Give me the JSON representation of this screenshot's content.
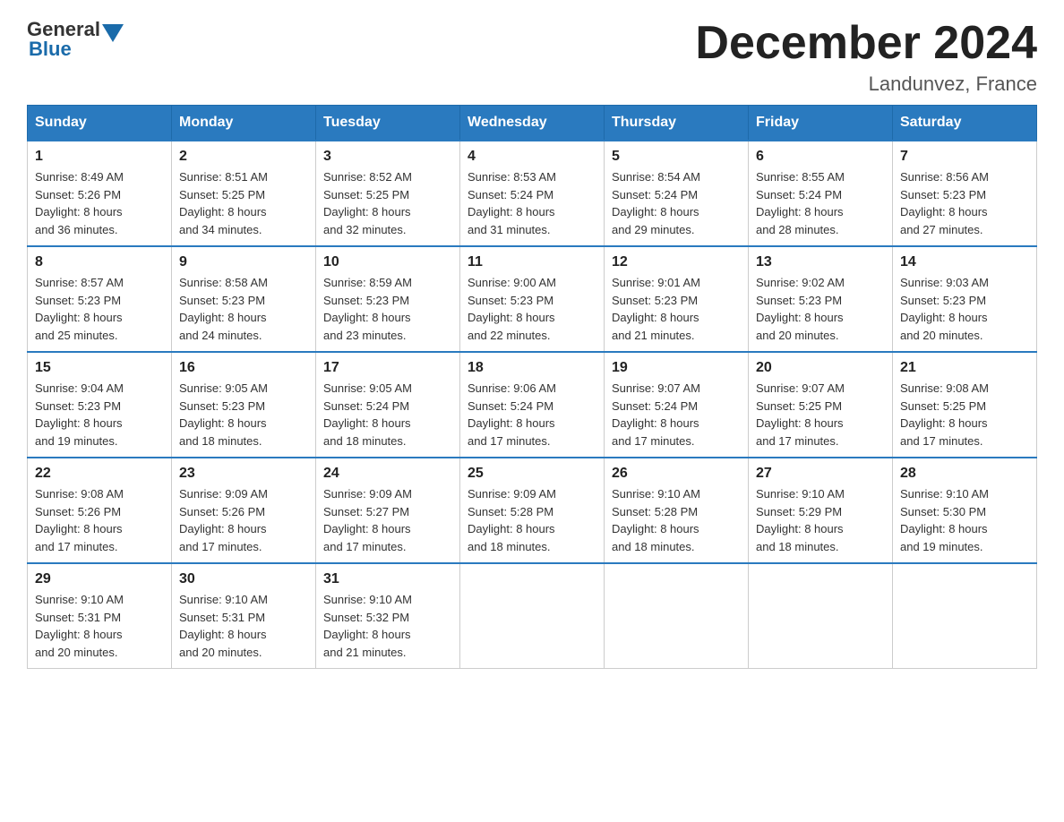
{
  "header": {
    "logo_general": "General",
    "logo_blue": "Blue",
    "month_title": "December 2024",
    "location": "Landunvez, France"
  },
  "days_of_week": [
    "Sunday",
    "Monday",
    "Tuesday",
    "Wednesday",
    "Thursday",
    "Friday",
    "Saturday"
  ],
  "weeks": [
    [
      {
        "day": "1",
        "sunrise": "8:49 AM",
        "sunset": "5:26 PM",
        "daylight": "8 hours and 36 minutes."
      },
      {
        "day": "2",
        "sunrise": "8:51 AM",
        "sunset": "5:25 PM",
        "daylight": "8 hours and 34 minutes."
      },
      {
        "day": "3",
        "sunrise": "8:52 AM",
        "sunset": "5:25 PM",
        "daylight": "8 hours and 32 minutes."
      },
      {
        "day": "4",
        "sunrise": "8:53 AM",
        "sunset": "5:24 PM",
        "daylight": "8 hours and 31 minutes."
      },
      {
        "day": "5",
        "sunrise": "8:54 AM",
        "sunset": "5:24 PM",
        "daylight": "8 hours and 29 minutes."
      },
      {
        "day": "6",
        "sunrise": "8:55 AM",
        "sunset": "5:24 PM",
        "daylight": "8 hours and 28 minutes."
      },
      {
        "day": "7",
        "sunrise": "8:56 AM",
        "sunset": "5:23 PM",
        "daylight": "8 hours and 27 minutes."
      }
    ],
    [
      {
        "day": "8",
        "sunrise": "8:57 AM",
        "sunset": "5:23 PM",
        "daylight": "8 hours and 25 minutes."
      },
      {
        "day": "9",
        "sunrise": "8:58 AM",
        "sunset": "5:23 PM",
        "daylight": "8 hours and 24 minutes."
      },
      {
        "day": "10",
        "sunrise": "8:59 AM",
        "sunset": "5:23 PM",
        "daylight": "8 hours and 23 minutes."
      },
      {
        "day": "11",
        "sunrise": "9:00 AM",
        "sunset": "5:23 PM",
        "daylight": "8 hours and 22 minutes."
      },
      {
        "day": "12",
        "sunrise": "9:01 AM",
        "sunset": "5:23 PM",
        "daylight": "8 hours and 21 minutes."
      },
      {
        "day": "13",
        "sunrise": "9:02 AM",
        "sunset": "5:23 PM",
        "daylight": "8 hours and 20 minutes."
      },
      {
        "day": "14",
        "sunrise": "9:03 AM",
        "sunset": "5:23 PM",
        "daylight": "8 hours and 20 minutes."
      }
    ],
    [
      {
        "day": "15",
        "sunrise": "9:04 AM",
        "sunset": "5:23 PM",
        "daylight": "8 hours and 19 minutes."
      },
      {
        "day": "16",
        "sunrise": "9:05 AM",
        "sunset": "5:23 PM",
        "daylight": "8 hours and 18 minutes."
      },
      {
        "day": "17",
        "sunrise": "9:05 AM",
        "sunset": "5:24 PM",
        "daylight": "8 hours and 18 minutes."
      },
      {
        "day": "18",
        "sunrise": "9:06 AM",
        "sunset": "5:24 PM",
        "daylight": "8 hours and 17 minutes."
      },
      {
        "day": "19",
        "sunrise": "9:07 AM",
        "sunset": "5:24 PM",
        "daylight": "8 hours and 17 minutes."
      },
      {
        "day": "20",
        "sunrise": "9:07 AM",
        "sunset": "5:25 PM",
        "daylight": "8 hours and 17 minutes."
      },
      {
        "day": "21",
        "sunrise": "9:08 AM",
        "sunset": "5:25 PM",
        "daylight": "8 hours and 17 minutes."
      }
    ],
    [
      {
        "day": "22",
        "sunrise": "9:08 AM",
        "sunset": "5:26 PM",
        "daylight": "8 hours and 17 minutes."
      },
      {
        "day": "23",
        "sunrise": "9:09 AM",
        "sunset": "5:26 PM",
        "daylight": "8 hours and 17 minutes."
      },
      {
        "day": "24",
        "sunrise": "9:09 AM",
        "sunset": "5:27 PM",
        "daylight": "8 hours and 17 minutes."
      },
      {
        "day": "25",
        "sunrise": "9:09 AM",
        "sunset": "5:28 PM",
        "daylight": "8 hours and 18 minutes."
      },
      {
        "day": "26",
        "sunrise": "9:10 AM",
        "sunset": "5:28 PM",
        "daylight": "8 hours and 18 minutes."
      },
      {
        "day": "27",
        "sunrise": "9:10 AM",
        "sunset": "5:29 PM",
        "daylight": "8 hours and 18 minutes."
      },
      {
        "day": "28",
        "sunrise": "9:10 AM",
        "sunset": "5:30 PM",
        "daylight": "8 hours and 19 minutes."
      }
    ],
    [
      {
        "day": "29",
        "sunrise": "9:10 AM",
        "sunset": "5:31 PM",
        "daylight": "8 hours and 20 minutes."
      },
      {
        "day": "30",
        "sunrise": "9:10 AM",
        "sunset": "5:31 PM",
        "daylight": "8 hours and 20 minutes."
      },
      {
        "day": "31",
        "sunrise": "9:10 AM",
        "sunset": "5:32 PM",
        "daylight": "8 hours and 21 minutes."
      },
      null,
      null,
      null,
      null
    ]
  ],
  "labels": {
    "sunrise": "Sunrise:",
    "sunset": "Sunset:",
    "daylight": "Daylight:"
  }
}
